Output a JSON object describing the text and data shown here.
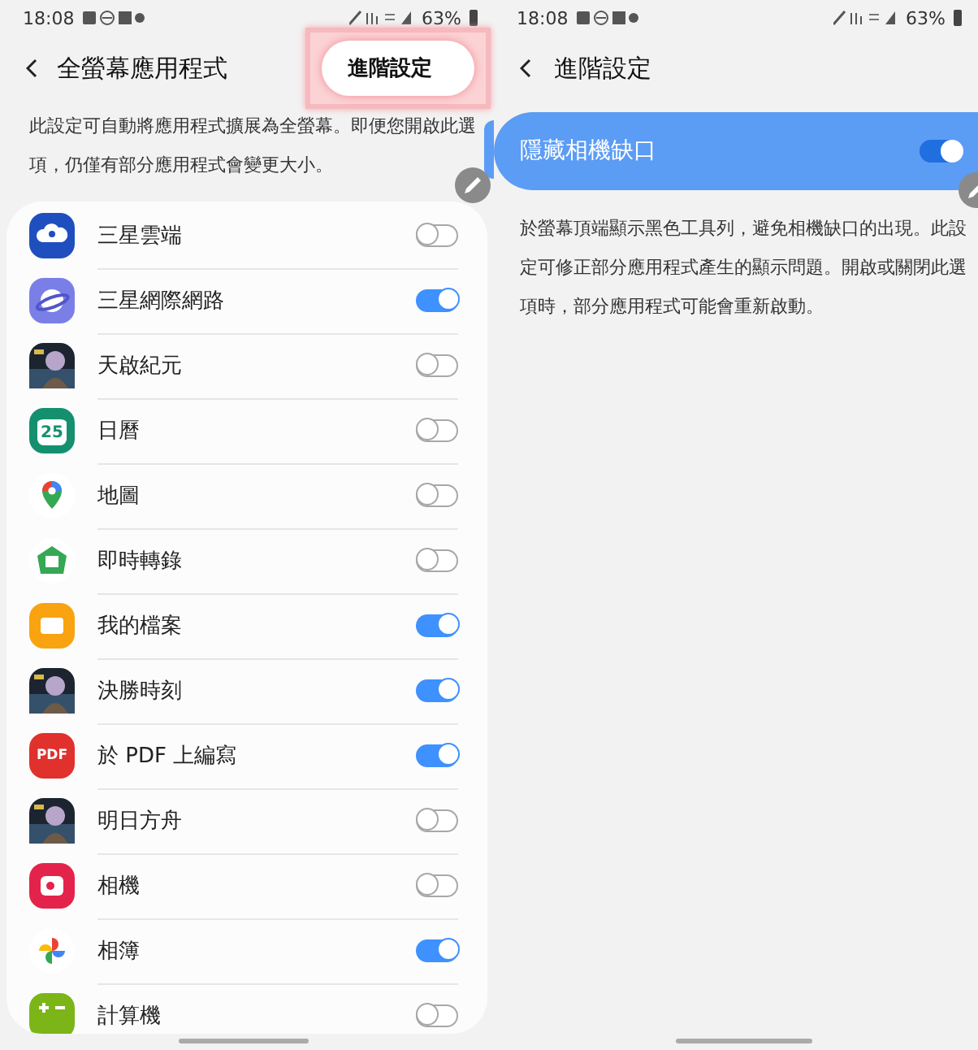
{
  "left_screen": {
    "status_bar": {
      "time": "18:08",
      "battery": "63%"
    },
    "header": {
      "title": "全螢幕應用程式",
      "advanced_button": "進階設定"
    },
    "description": "此設定可自動將應用程式擴展為全螢幕。即便您開啟此選項，仍僅有部分應用程式會變更大小。",
    "apps": [
      {
        "name": "三星雲端",
        "kind": "cloud",
        "on": false
      },
      {
        "name": "三星網際網路",
        "kind": "browser",
        "on": true
      },
      {
        "name": "天啟紀元",
        "kind": "picture",
        "on": false
      },
      {
        "name": "日曆",
        "kind": "calendar",
        "icon_text": "25",
        "on": false
      },
      {
        "name": "地圖",
        "kind": "maps",
        "on": false
      },
      {
        "name": "即時轉錄",
        "kind": "transcribe",
        "on": false
      },
      {
        "name": "我的檔案",
        "kind": "folder",
        "on": true
      },
      {
        "name": "決勝時刻",
        "kind": "picture",
        "on": true
      },
      {
        "name": "於 PDF 上編寫",
        "kind": "pdf",
        "icon_text": "PDF",
        "on": true
      },
      {
        "name": "明日方舟",
        "kind": "picture",
        "on": false
      },
      {
        "name": "相機",
        "kind": "camera",
        "on": false
      },
      {
        "name": "相簿",
        "kind": "photos",
        "on": true
      },
      {
        "name": "計算機",
        "kind": "calculator",
        "on": false
      }
    ]
  },
  "right_screen": {
    "status_bar": {
      "time": "18:08",
      "battery": "63%"
    },
    "header": {
      "title": "進階設定"
    },
    "setting": {
      "label": "隱藏相機缺口",
      "on": true
    },
    "description": "於螢幕頂端顯示黑色工具列，避免相機缺口的出現。此設定可修正部分應用程式產生的顯示問題。開啟或關閉此選項時，部分應用程式可能會重新啟動。"
  }
}
